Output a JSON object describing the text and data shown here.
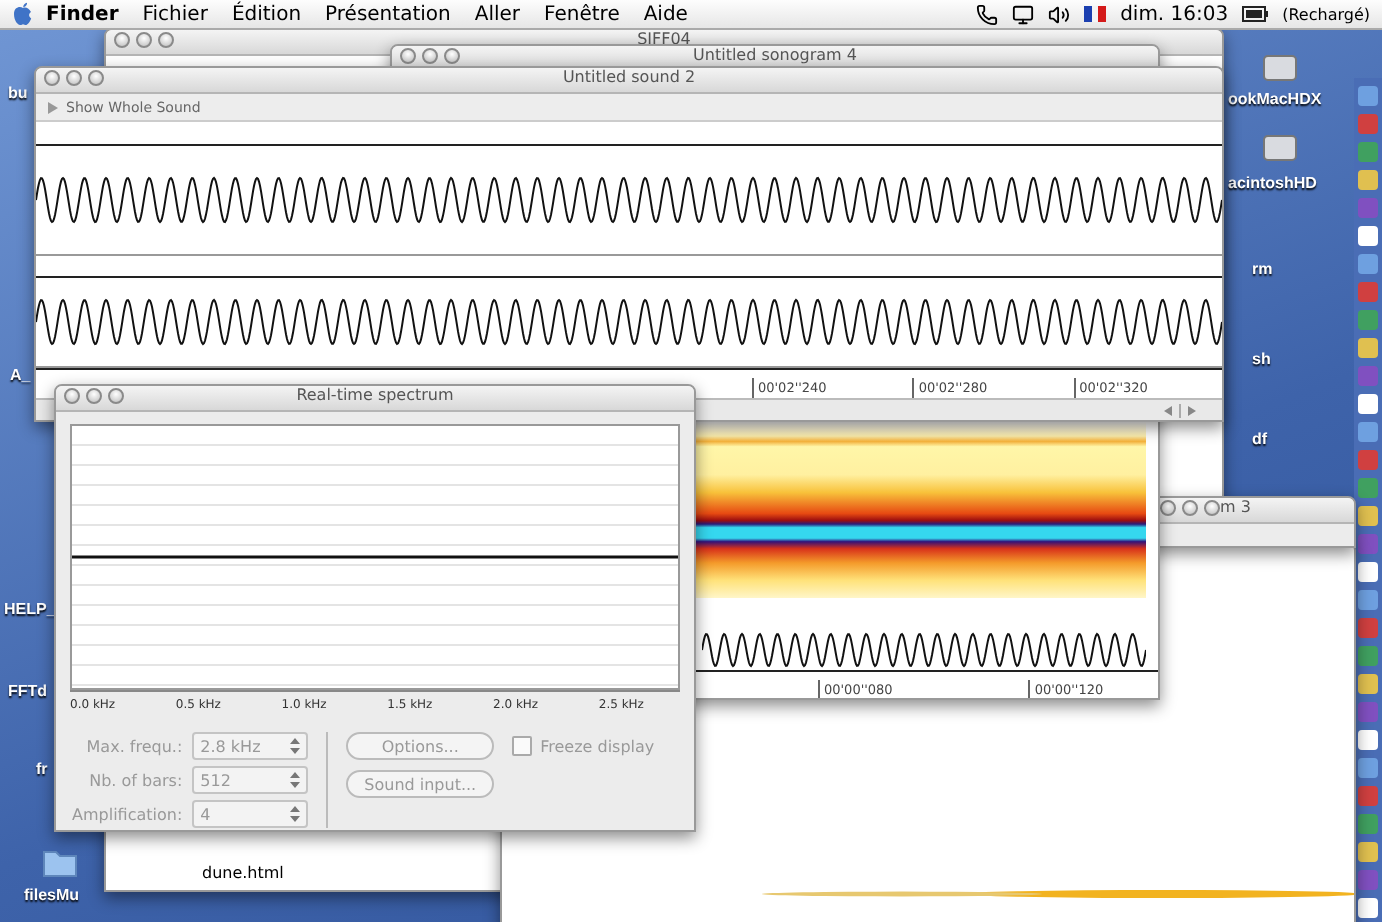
{
  "menu_bar": {
    "app": "Finder",
    "menus": [
      "Fichier",
      "Édition",
      "Présentation",
      "Aller",
      "Fenêtre",
      "Aide"
    ],
    "clock": "dim. 16:03",
    "battery": "(Rechargé)"
  },
  "desktop_left": [
    "bu",
    "A_",
    "HELP_",
    "FFTd",
    "fr",
    "filesMu"
  ],
  "desktop_right": [
    "ookMacHDX",
    "acintoshHD",
    "rm",
    "sh",
    "df"
  ],
  "back_window": {
    "title": "SIFF04",
    "file": "dune.html"
  },
  "side_window": {
    "title": "m 3"
  },
  "sonogram_window": {
    "title": "Untitled sonogram 4",
    "time_labels": [
      "00'00''080",
      "00'00''120"
    ]
  },
  "sound_window": {
    "title": "Untitled sound 2",
    "toggle": "Show Whole Sound",
    "time_labels": [
      "00'02''240",
      "00'02''280",
      "00'02''320"
    ]
  },
  "spectrum_window": {
    "title": "Real-time spectrum",
    "freq_labels": [
      "0.0 kHz",
      "0.5 kHz",
      "1.0 kHz",
      "1.5 kHz",
      "2.0 kHz",
      "2.5 kHz"
    ],
    "fields": [
      {
        "label": "Max. frequ.:",
        "value": "2.8 kHz"
      },
      {
        "label": "Nb. of bars:",
        "value": "512"
      },
      {
        "label": "Amplification:",
        "value": "4"
      }
    ],
    "buttons": [
      "Options...",
      "Sound input..."
    ],
    "freeze": {
      "label": "Freeze display",
      "checked": false
    },
    "disabled": true
  }
}
